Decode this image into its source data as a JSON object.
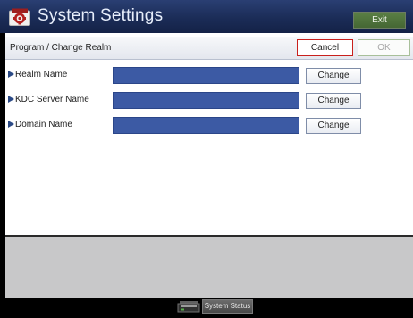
{
  "header": {
    "title": "System Settings",
    "exit_label": "Exit",
    "icon": "system-settings-icon"
  },
  "subbar": {
    "title": "Program / Change Realm",
    "cancel_label": "Cancel",
    "ok_label": "OK"
  },
  "rows": [
    {
      "label": "Realm Name",
      "value": "",
      "change_label": "Change"
    },
    {
      "label": "KDC Server Name",
      "value": "",
      "change_label": "Change"
    },
    {
      "label": "Domain Name",
      "value": "",
      "change_label": "Change"
    }
  ],
  "footer": {
    "system_status_label": "System Status",
    "status_icon": "machine-status-icon"
  },
  "colors": {
    "header_bg": "#1b2c57",
    "field_bg": "#3c5aa4",
    "exit_bg": "#4f733c",
    "cancel_border": "#c9201c"
  }
}
